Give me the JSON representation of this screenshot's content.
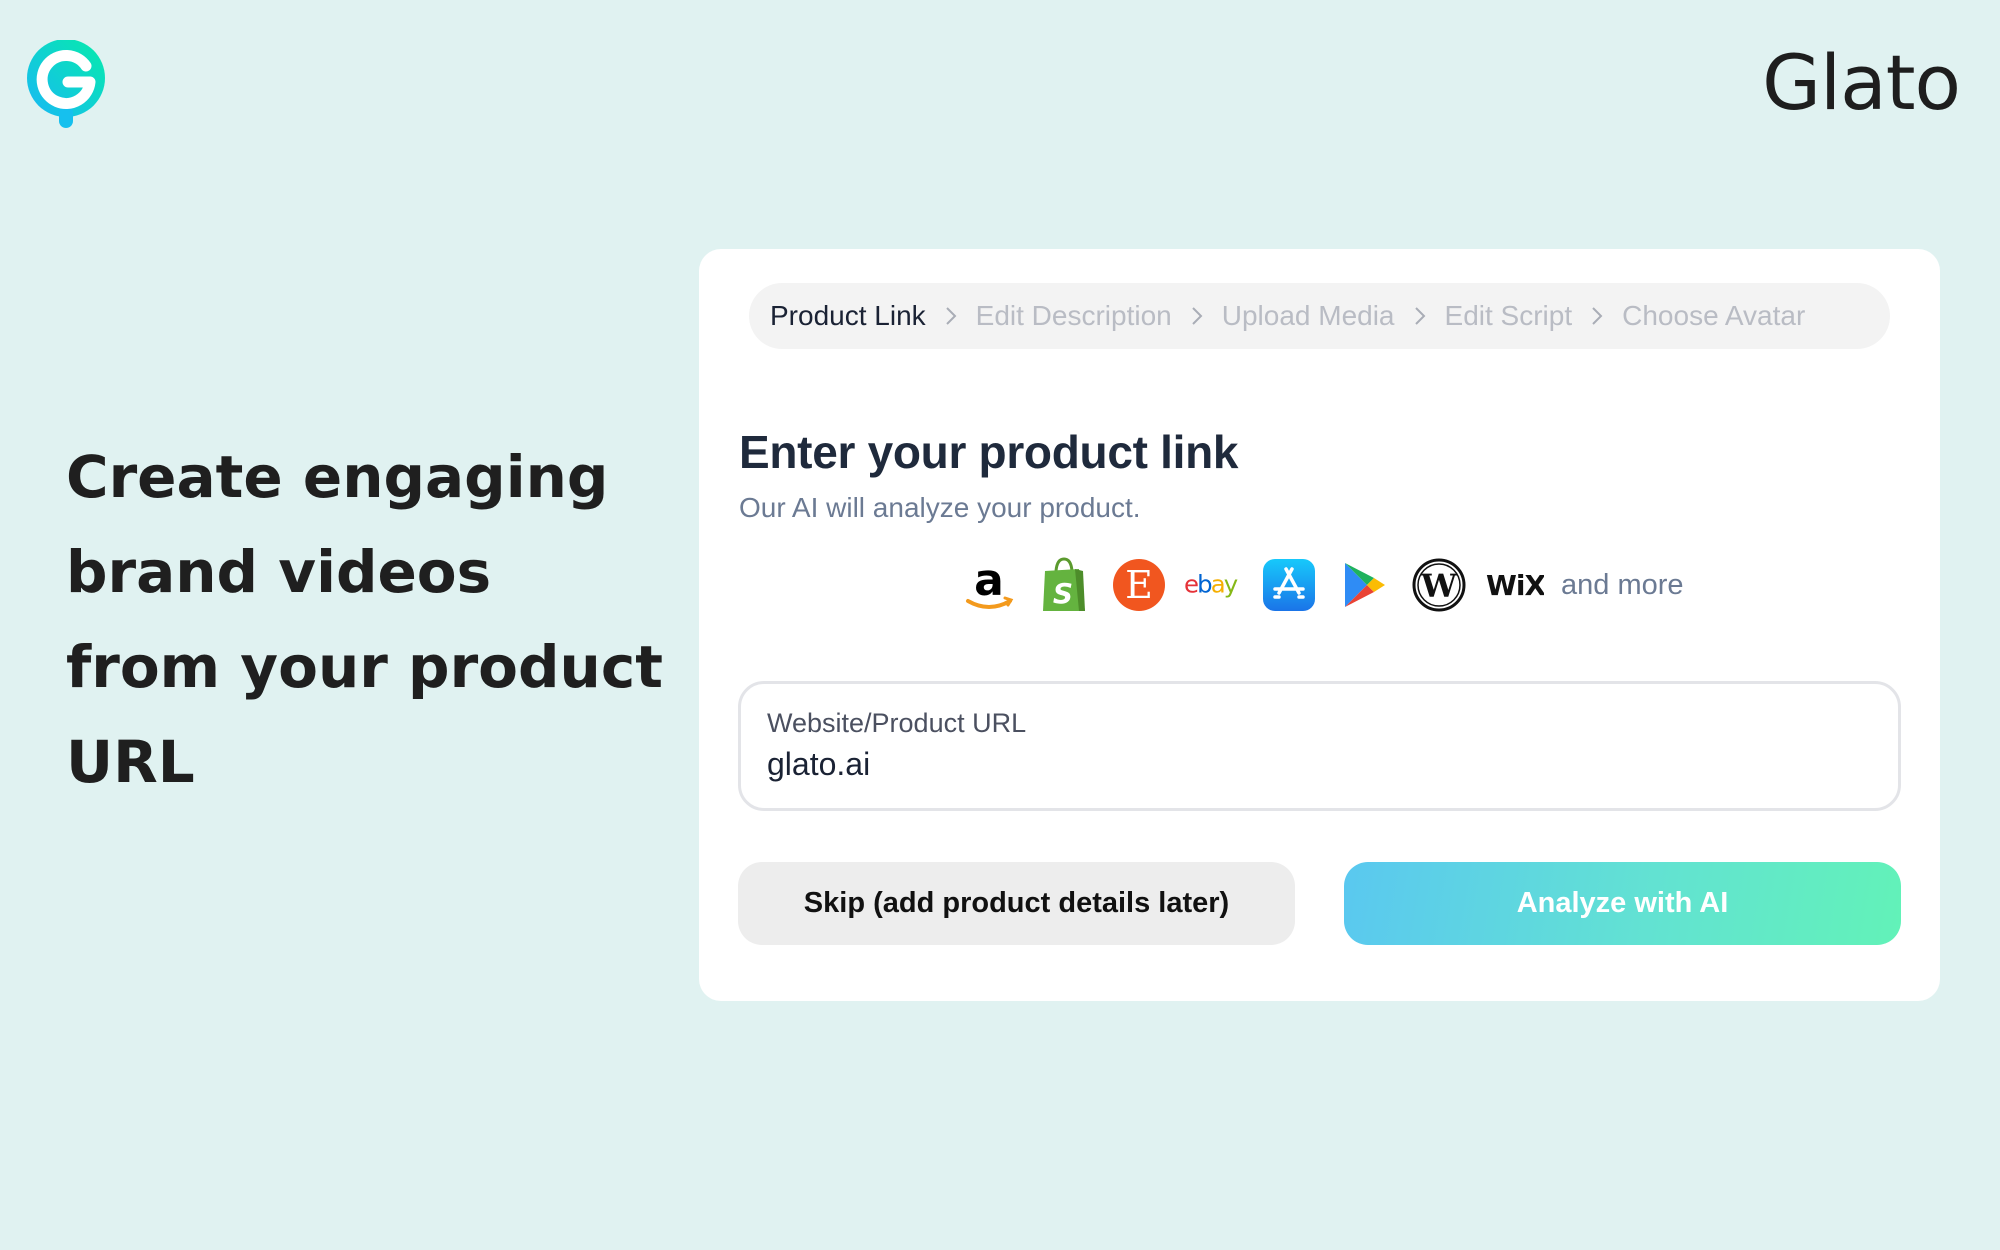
{
  "header": {
    "logo_icon": "glato-g-logo-icon",
    "brand_name": "Glato"
  },
  "hero": {
    "lines": [
      "Create engaging",
      "brand videos",
      "from your product",
      "URL"
    ]
  },
  "stepper": {
    "steps": [
      {
        "label": "Product Link",
        "active": true
      },
      {
        "label": "Edit Description",
        "active": false
      },
      {
        "label": "Upload Media",
        "active": false
      },
      {
        "label": "Edit Script",
        "active": false
      },
      {
        "label": "Choose Avatar",
        "active": false
      }
    ],
    "separator_icon": "chevron-right-icon"
  },
  "form": {
    "title": "Enter your product link",
    "subtitle": "Our AI will analyze your product.",
    "platforms": [
      "amazon",
      "shopify",
      "etsy",
      "ebay",
      "app-store",
      "google-play",
      "wordpress",
      "wix"
    ],
    "platforms_more": "and more",
    "url_label": "Website/Product URL",
    "url_value": "glato.ai",
    "skip_label": "Skip (add product details later)",
    "analyze_label": "Analyze with AI"
  },
  "colors": {
    "background": "#e0f2f1",
    "accent_gradient_start": "#5ac8f0",
    "accent_gradient_end": "#62f2b8",
    "title": "#1f2a3c",
    "muted": "#6b7a93"
  }
}
